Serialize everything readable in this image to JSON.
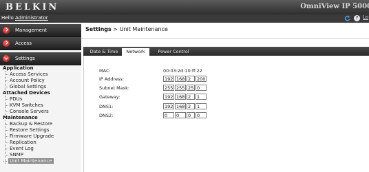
{
  "header": {
    "brand": "BELKIN",
    "product": "OmniView IP 5000",
    "hello_prefix": "Hello ",
    "user": "Administrator",
    "help_icon_glyph": "?",
    "logout_partial": "Lo"
  },
  "nav": {
    "buttons": [
      {
        "label": "Management"
      },
      {
        "label": "Access"
      },
      {
        "label": "Settings"
      }
    ],
    "groups": [
      {
        "title": "Application",
        "items": [
          "Access Services",
          "Account Policy",
          "Global Settings"
        ]
      },
      {
        "title": "Attached Devices",
        "items": [
          "PDUs",
          "KVM Switches",
          "Console Servers"
        ]
      },
      {
        "title": "Maintenance",
        "items": [
          "Backup & Restore",
          "Restore Settings",
          "Firmware Upgrade",
          "Replication",
          "Event Log",
          "SNMP",
          "Unit Maintenance"
        ]
      }
    ],
    "active_item": "Unit Maintenance"
  },
  "breadcrumb": {
    "section": "Settings",
    "separator": " > ",
    "page": "Unit Maintenance"
  },
  "tabs": [
    {
      "label": "Date & Time",
      "active": false
    },
    {
      "label": "Network",
      "active": true
    },
    {
      "label": "Power Control",
      "active": false
    }
  ],
  "network": {
    "mac_label": "MAC:",
    "mac_value": "00:03:2d:10:ff:22",
    "ip_label": "IP Address:",
    "ip": [
      "192",
      "168",
      "2",
      "200"
    ],
    "subnet_label": "Subnet Mask:",
    "subnet": [
      "255",
      "255",
      "255",
      "0"
    ],
    "gateway_label": "Gateway:",
    "gateway": [
      "192",
      "168",
      "2",
      "1"
    ],
    "dns1_label": "DNS1:",
    "dns1": [
      "192",
      "168",
      "2",
      "1"
    ],
    "dns2_label": "DNS2:",
    "dns2": [
      "0",
      "0",
      "0",
      "0"
    ]
  },
  "colors": {
    "header_dark": "#2e2e2e",
    "nav_dot_red": "#d42a2a",
    "active_item_bg": "#8a8a8a"
  }
}
